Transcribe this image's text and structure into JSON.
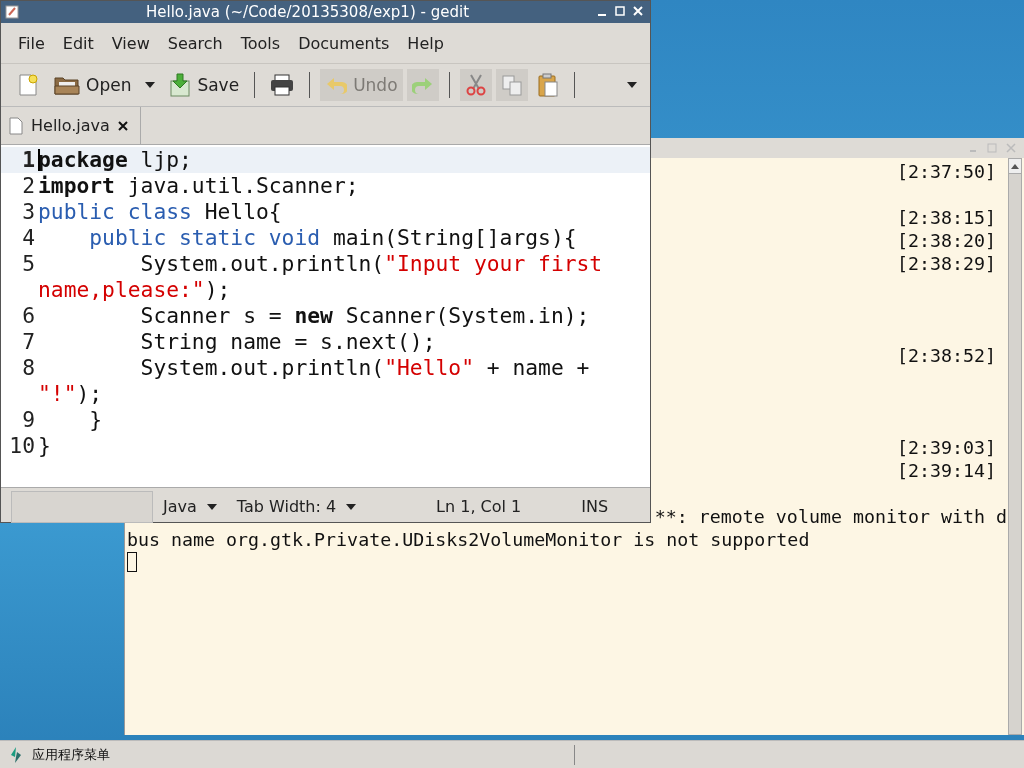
{
  "gedit": {
    "title": "Hello.java (~/Code/20135308/exp1) - gedit",
    "menu": [
      "File",
      "Edit",
      "View",
      "Search",
      "Tools",
      "Documents",
      "Help"
    ],
    "toolbar": [
      {
        "kind": "new",
        "disabled": false
      },
      {
        "kind": "open",
        "label": "Open",
        "disabled": false
      },
      {
        "kind": "dropdown",
        "disabled": false
      },
      {
        "kind": "save",
        "label": "Save",
        "disabled": false
      },
      {
        "kind": "separator"
      },
      {
        "kind": "print",
        "disabled": false
      },
      {
        "kind": "separator"
      },
      {
        "kind": "undo",
        "label": "Undo",
        "disabled": true
      },
      {
        "kind": "redo",
        "disabled": true
      },
      {
        "kind": "separator"
      },
      {
        "kind": "cut",
        "disabled": true
      },
      {
        "kind": "copy",
        "disabled": true
      },
      {
        "kind": "paste",
        "disabled": false
      },
      {
        "kind": "separator"
      },
      {
        "kind": "overflow",
        "disabled": false
      }
    ],
    "tabs": [
      {
        "label": "Hello.java",
        "selected": true
      }
    ],
    "code": [
      {
        "number": "1",
        "current": true,
        "tokens": [
          {
            "kind": "bold",
            "text": "package"
          },
          {
            "kind": "plain",
            "text": " ljp;"
          }
        ]
      },
      {
        "number": "2",
        "current": false,
        "tokens": [
          {
            "kind": "bold",
            "text": "import"
          },
          {
            "kind": "plain",
            "text": " java.util.Scanner;"
          }
        ]
      },
      {
        "number": "3",
        "current": false,
        "tokens": [
          {
            "kind": "keyword",
            "text": "public class"
          },
          {
            "kind": "plain",
            "text": " Hello{"
          }
        ]
      },
      {
        "number": "4",
        "current": false,
        "tokens": [
          {
            "kind": "keyword",
            "text": "    public static void"
          },
          {
            "kind": "plain",
            "text": " main(String[]args){"
          }
        ]
      },
      {
        "number": "5",
        "current": false,
        "tokens": [
          {
            "kind": "plain",
            "text": "        System.out.println("
          },
          {
            "kind": "string",
            "text": "\"Input your first name,please:\""
          },
          {
            "kind": "plain",
            "text": ");"
          }
        ]
      },
      {
        "number": "6",
        "current": false,
        "tokens": [
          {
            "kind": "plain",
            "text": "        Scanner s = "
          },
          {
            "kind": "bold",
            "text": "new"
          },
          {
            "kind": "plain",
            "text": " Scanner(System.in);"
          }
        ]
      },
      {
        "number": "7",
        "current": false,
        "tokens": [
          {
            "kind": "plain",
            "text": "        String name = s.next();"
          }
        ]
      },
      {
        "number": "8",
        "current": false,
        "tokens": [
          {
            "kind": "plain",
            "text": "        System.out.println("
          },
          {
            "kind": "string",
            "text": "\"Hello\""
          },
          {
            "kind": "plain",
            "text": " + name + "
          },
          {
            "kind": "string",
            "text": "\"!\""
          },
          {
            "kind": "plain",
            "text": ");"
          }
        ]
      },
      {
        "number": "9",
        "current": false,
        "tokens": [
          {
            "kind": "plain",
            "text": "    }"
          }
        ]
      },
      {
        "number": "10",
        "current": false,
        "tokens": [
          {
            "kind": "plain",
            "text": "}"
          }
        ]
      }
    ],
    "status_bar": {
      "language": "Java",
      "tab_width": "Tab Width: 4",
      "position": "Ln 1, Col 1",
      "mode": "INS"
    }
  },
  "terminal": {
    "lines": [
      {
        "kind": "time",
        "time": "[2:37:50]"
      },
      {
        "kind": "blank"
      },
      {
        "kind": "time",
        "time": "[2:38:15]"
      },
      {
        "kind": "time",
        "time": "[2:38:20]"
      },
      {
        "kind": "time",
        "time": "[2:38:29]"
      },
      {
        "kind": "blank"
      },
      {
        "kind": "blank"
      },
      {
        "kind": "blank"
      },
      {
        "kind": "time",
        "time": "[2:38:52]"
      },
      {
        "kind": "blank"
      },
      {
        "kind": "blank"
      },
      {
        "kind": "blank"
      },
      {
        "kind": "time",
        "time": "[2:39:03]"
      },
      {
        "kind": "time",
        "time": "[2:39:14]"
      },
      {
        "kind": "blank"
      },
      {
        "kind": "wrapped",
        "text": "**: remote volume monitor with d"
      },
      {
        "kind": "output",
        "text": "bus name org.gtk.Private.UDisks2VolumeMonitor is not supported"
      },
      {
        "kind": "cursor"
      }
    ]
  },
  "taskbar": {
    "menu": "应用程序菜单"
  }
}
